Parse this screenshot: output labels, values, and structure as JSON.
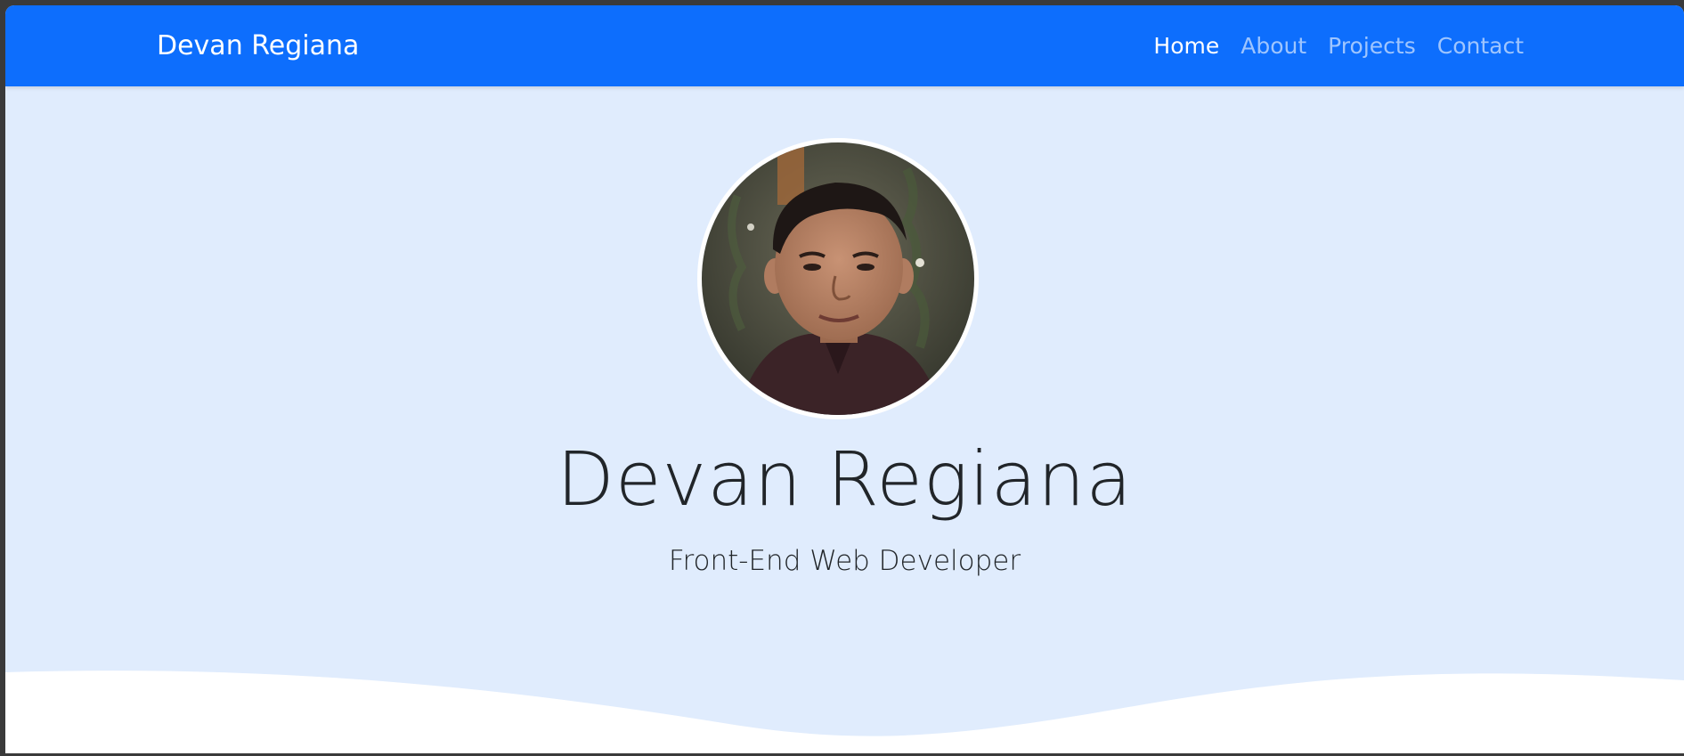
{
  "navbar": {
    "brand": "Devan Regiana",
    "links": [
      {
        "label": "Home",
        "active": true
      },
      {
        "label": "About",
        "active": false
      },
      {
        "label": "Projects",
        "active": false
      },
      {
        "label": "Contact",
        "active": false
      }
    ]
  },
  "hero": {
    "name": "Devan Regiana",
    "role": "Front-End Web Developer"
  },
  "colors": {
    "navbar": "#0d6efd",
    "hero_bg": "#e0ecfd",
    "wave": "#ffffff",
    "text": "#212529"
  }
}
